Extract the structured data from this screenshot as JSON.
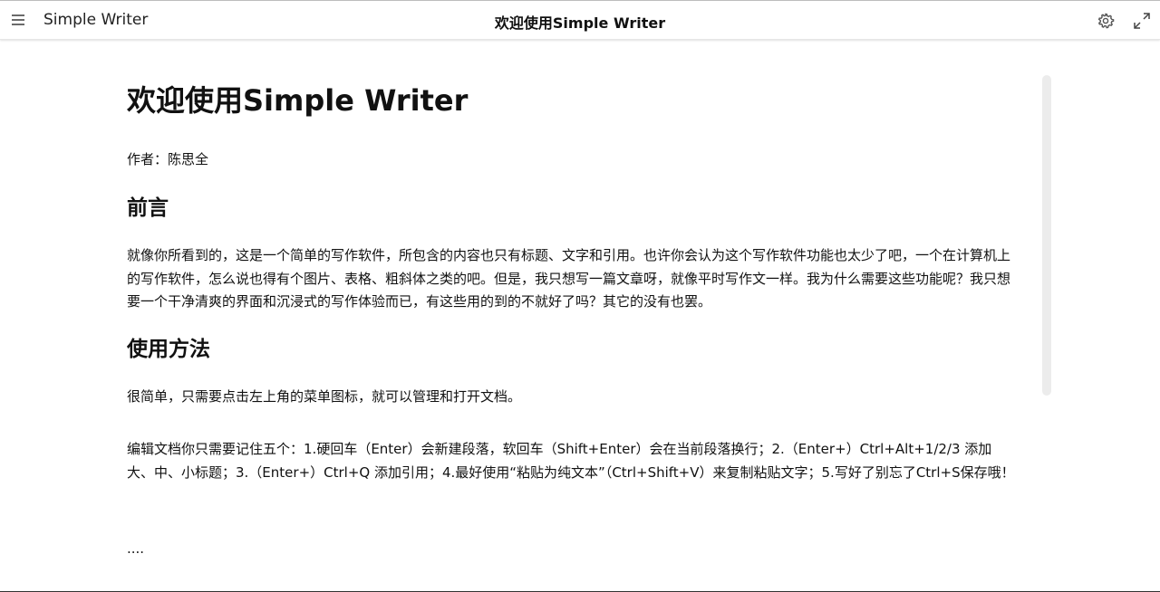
{
  "app": {
    "name": "Simple Writer",
    "document_title": "欢迎使用Simple Writer"
  },
  "toolbar": {
    "menu_icon": "hamburger-menu-icon",
    "settings_icon": "gear-icon",
    "fullscreen_icon": "expand-icon"
  },
  "document": {
    "title": "欢迎使用Simple Writer",
    "author_line": "作者：陈思全",
    "sections": [
      {
        "heading": "前言",
        "paragraphs": [
          "就像你所看到的，这是一个简单的写作软件，所包含的内容也只有标题、文字和引用。也许你会认为这个写作软件功能也太少了吧，一个在计算机上的写作软件，怎么说也得有个图片、表格、粗斜体之类的吧。但是，我只想写一篇文章呀，就像平时写作文一样。我为什么需要这些功能呢？我只想要一个干净清爽的界面和沉浸式的写作体验而已，有这些用的到的不就好了吗？其它的没有也罢。"
        ]
      },
      {
        "heading": "使用方法",
        "paragraphs": [
          "很简单，只需要点击左上角的菜单图标，就可以管理和打开文档。",
          "编辑文档你只需要记住五个：1.硬回车（Enter）会新建段落，软回车（Shift+Enter）会在当前段落换行；2.（Enter+）Ctrl+Alt+1/2/3 添加大、中、小标题；3.（Enter+）Ctrl+Q 添加引用；4.最好使用“粘贴为纯文本”（Ctrl+Shift+V）来复制粘贴文字；5.写好了别忘了Ctrl+S保存哦！",
          "...."
        ]
      }
    ]
  }
}
